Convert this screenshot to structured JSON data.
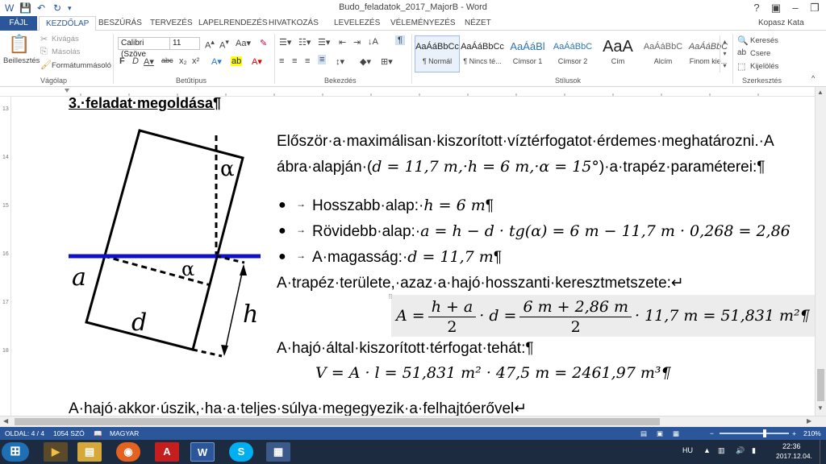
{
  "window": {
    "title": "Budo_feladatok_2017_MajorB - Word",
    "user": "Kopasz Kata",
    "help": "?"
  },
  "tabs": [
    "FÁJL",
    "KEZDŐLAP",
    "BESZÚRÁS",
    "TERVEZÉS",
    "LAPELRENDEZÉS",
    "HIVATKOZÁS",
    "LEVELEZÉS",
    "VÉLEMÉNYEZÉS",
    "NÉZET"
  ],
  "ribbon": {
    "clipboard": {
      "paste": "Beillesztés",
      "cut": "Kivágás",
      "copy": "Másolás",
      "format_painter": "Formátummásoló",
      "label": "Vágólap"
    },
    "font": {
      "name": "Calibri (Szöve",
      "size": "11",
      "label": "Betűtípus"
    },
    "paragraph": {
      "label": "Bekezdés"
    },
    "styles": {
      "label": "Stílusok",
      "items": [
        {
          "preview": "AaÁáBbCc",
          "name": "¶ Normál"
        },
        {
          "preview": "AaÁáBbCc",
          "name": "¶ Nincs té..."
        },
        {
          "preview": "AaÁáBl",
          "name": "Címsor 1"
        },
        {
          "preview": "AaÁáBbC",
          "name": "Címsor 2"
        },
        {
          "preview": "AaA",
          "name": "Cím"
        },
        {
          "preview": "AaÁáBbC",
          "name": "Alcím"
        },
        {
          "preview": "AaÁáBbC",
          "name": "Finom kie..."
        }
      ]
    },
    "editing": {
      "find": "Keresés",
      "replace": "Csere",
      "select": "Kijelölés",
      "label": "Szerkesztés"
    }
  },
  "document": {
    "heading": "3.·feladat·megoldása¶",
    "figure_labels": {
      "alpha_top": "α",
      "alpha_mid": "α",
      "a": "a",
      "d": "d",
      "h": "h"
    },
    "para1_line1": "Először·a·maximálisan·kiszorított·víztérfogatot·érdemes·meghatározni.·A",
    "para1_line2_prefix": "ábra·alapján·(",
    "para1_line2_math": "d = 11,7 m,·h = 6 m,·α = 15°",
    "para1_line2_suffix": ")·a·trapéz·paraméterei:¶",
    "bullet1_label": "Hosszabb·alap:·",
    "bullet1_math": "h = 6 m",
    "bullet1_end": "¶",
    "bullet2_label": "Rövidebb·alap:·",
    "bullet2_math": "a = h − d · tg(α) = 6 m − 11,7 m  · 0,268 = 2,86",
    "bullet3_label": "A·magasság:·",
    "bullet3_math": "d = 11,7 m",
    "bullet3_end": "¶",
    "para2": "A·trapéz·területe,·azaz·a·hajó·hosszanti·keresztmetszete:↵",
    "eq1_lhs": "A =",
    "eq1_num1": "h + a",
    "eq1_den1": "2",
    "eq1_mid": "· d =",
    "eq1_num2": "6 m + 2,86 m",
    "eq1_den2": "2",
    "eq1_rhs": "· 11,7 m = 51,831 m²¶",
    "para3": "A·hajó·által·kiszorított·térfogat·tehát:¶",
    "eq2": "V = A · l = 51,831 m² · 47,5 m = 2461,97 m³¶",
    "para4": "A·hajó·akkor·úszik,·ha·a·teljes·súlya·megegyezik·a·felhajtóerővel↵"
  },
  "vruler_numbers": [
    "13",
    "14",
    "15",
    "16",
    "17",
    "18"
  ],
  "status": {
    "page": "OLDAL: 4 / 4",
    "words": "1054 SZÓ",
    "lang": "MAGYAR",
    "zoom": "210%"
  },
  "taskbar": {
    "lang": "HU",
    "time": "22:36",
    "date": "2017.12.04."
  },
  "colors": {
    "word_blue": "#2b579a",
    "waterline": "#1010c8"
  }
}
